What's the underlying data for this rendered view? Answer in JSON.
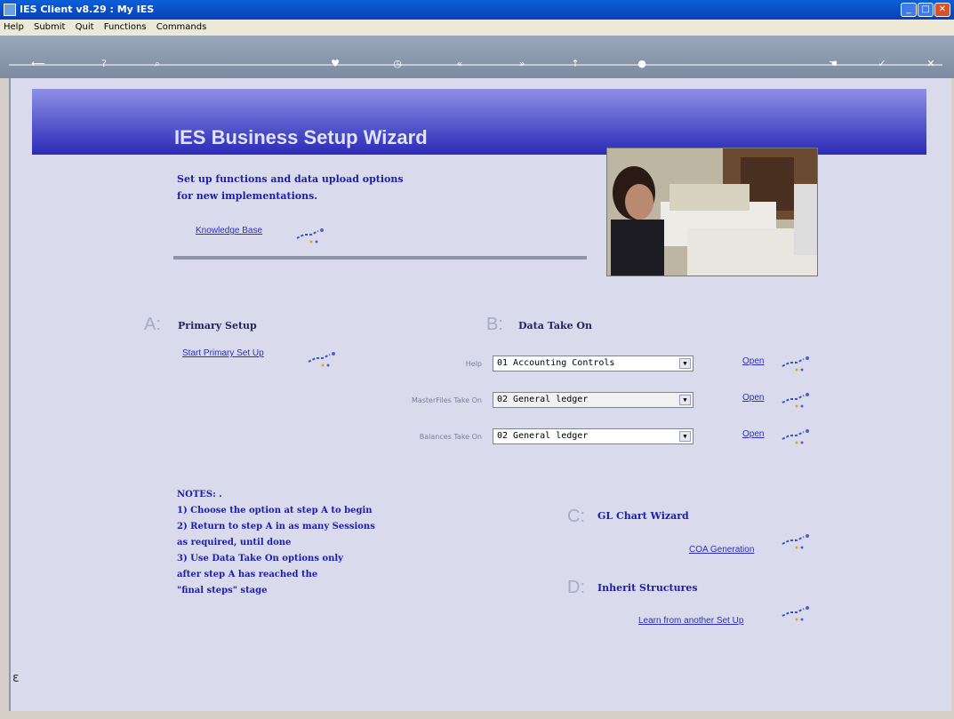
{
  "window": {
    "title": "IES Client v8.29 : My IES"
  },
  "menu": [
    "Help",
    "Submit",
    "Quit",
    "Functions",
    "Commands"
  ],
  "toolbar_icons": [
    "back-arrow-icon",
    "help-icon",
    "search-icon",
    "heart-icon",
    "clock-icon",
    "rewind-icon",
    "forward-icon",
    "up-icon",
    "circle-icon",
    "hand-icon",
    "check-icon",
    "close-icon"
  ],
  "banner": {
    "title": "IES Business Setup Wizard"
  },
  "intro": {
    "line1": "Set up functions and data upload options",
    "line2": "for new implementations.",
    "kb_link": "Knowledge Base"
  },
  "sectionA": {
    "letter": "A:",
    "title": "Primary Setup",
    "link": "Start Primary Set Up"
  },
  "sectionB": {
    "letter": "B:",
    "title": "Data Take On",
    "rows": [
      {
        "label": "Help",
        "value": "01 Accounting Controls",
        "open": "Open"
      },
      {
        "label": "MasterFiles Take On",
        "value": "02 General ledger",
        "open": "Open"
      },
      {
        "label": "Balances Take On",
        "value": "02 General ledger",
        "open": "Open"
      }
    ]
  },
  "sectionC": {
    "letter": "C:",
    "title": "GL Chart Wizard",
    "link": "COA Generation"
  },
  "sectionD": {
    "letter": "D:",
    "title": "Inherit Structures",
    "link": "Learn from another Set Up"
  },
  "notes": {
    "heading": "NOTES: .",
    "lines": [
      "1) Choose the option at step A to begin",
      "2) Return to step A in as many Sessions",
      "as required, until done",
      "3) Use Data Take On options only",
      "after step A has reached the",
      "\"final steps\" stage"
    ]
  },
  "colors": {
    "banner": "#2a2ab8",
    "link": "#2d2dc4",
    "content_bg": "#d9dbec"
  }
}
